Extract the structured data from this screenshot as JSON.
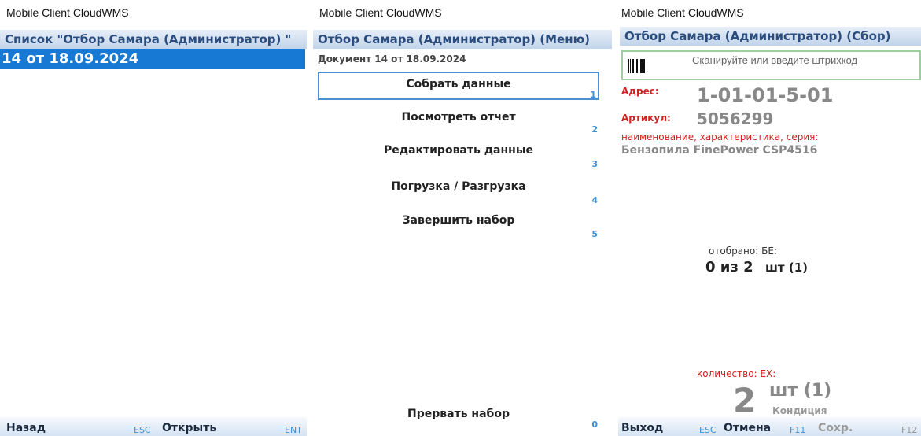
{
  "app_title": "Mobile Client CloudWMS",
  "screen1": {
    "header": "Список \"Отбор Самара (Администратор) \"",
    "selected_item": "14 от 18.09.2024",
    "footer": {
      "back_label": "Назад",
      "back_key": "ESC",
      "open_label": "Открыть",
      "open_key": "ENT"
    }
  },
  "screen2": {
    "header": "Отбор Самара (Администратор) (Меню)",
    "document": "Документ 14 от 18.09.2024",
    "menu": [
      {
        "label": "Собрать данные",
        "key": "1"
      },
      {
        "label": "Посмотреть отчет",
        "key": "2"
      },
      {
        "label": "Редактировать данные",
        "key": "3"
      },
      {
        "label": "Погрузка / Разгрузка",
        "key": "4"
      },
      {
        "label": "Завершить набор",
        "key": "5"
      }
    ],
    "abort": {
      "label": "Прервать набор",
      "key": "0"
    }
  },
  "screen3": {
    "header": "Отбор Самара (Администратор) (Сбор)",
    "scan_placeholder": "Сканируйте или введите штрихкод",
    "address_label": "Адрес:",
    "address_value": "1-01-01-5-01",
    "article_label": "Артикул:",
    "article_value": "5056299",
    "name_label": "наименование, характеристика, серия:",
    "name_value": "Бензопила FinePower CSP4516",
    "picked_label": "отобрано: БЕ:",
    "picked_value": "0 из 2",
    "picked_unit": "шт (1)",
    "qty_label": "количество: ЕХ:",
    "qty_value": "2",
    "qty_unit": "шт (1)",
    "qty_condition": "Кондиция",
    "footer": {
      "exit_label": "Выход",
      "exit_key": "ESC",
      "cancel_label": "Отмена",
      "cancel_key": "F11",
      "save_label": "Сохр.",
      "save_key": "F12"
    }
  }
}
